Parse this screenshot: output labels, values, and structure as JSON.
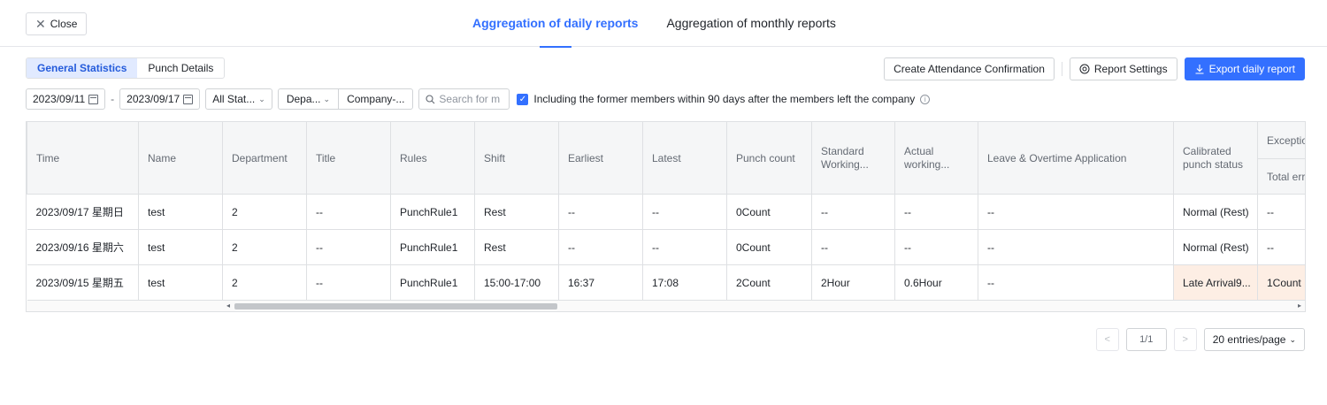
{
  "topbar": {
    "close_label": "Close",
    "tabs": [
      {
        "label": "Aggregation of daily reports",
        "active": true
      },
      {
        "label": "Aggregation of monthly reports",
        "active": false
      }
    ]
  },
  "view_toggle": {
    "items": [
      {
        "label": "General Statistics",
        "active": true
      },
      {
        "label": "Punch Details",
        "active": false
      }
    ]
  },
  "actions": {
    "create_confirmation": "Create Attendance Confirmation",
    "report_settings": "Report Settings",
    "export": "Export daily report"
  },
  "filters": {
    "start_date": "2023/09/11",
    "end_date": "2023/09/17",
    "status": "All Stat...",
    "department": "Depa...",
    "company": "Company-...",
    "search_placeholder": "Search for m",
    "include_former": {
      "checked": true,
      "label": "Including the former members within 90 days after the members left the company"
    }
  },
  "table": {
    "columns": [
      "Time",
      "Name",
      "Department",
      "Title",
      "Rules",
      "Shift",
      "Earliest",
      "Latest",
      "Punch count",
      "Standard Working...",
      "Actual working...",
      "Leave & Overtime Application",
      "Calibrated punch status",
      "Exceptio"
    ],
    "sub_header": "Total err",
    "rows": [
      [
        "2023/09/17 星期日",
        "test",
        "2",
        "--",
        "PunchRule1",
        "Rest",
        "--",
        "--",
        "0Count",
        "--",
        "--",
        "--",
        "Normal (Rest)",
        "--"
      ],
      [
        "2023/09/16 星期六",
        "test",
        "2",
        "--",
        "PunchRule1",
        "Rest",
        "--",
        "--",
        "0Count",
        "--",
        "--",
        "--",
        "Normal (Rest)",
        "--"
      ],
      [
        "2023/09/15 星期五",
        "test",
        "2",
        "--",
        "PunchRule1",
        "15:00-17:00",
        "16:37",
        "17:08",
        "2Count",
        "2Hour",
        "0.6Hour",
        "--",
        "Late Arrival9...",
        "1Count"
      ]
    ]
  },
  "pagination": {
    "page": "1/1",
    "page_size": "20 entries/page"
  },
  "colors": {
    "accent": "#3370ff",
    "highlight_cell": "#fdeee4"
  }
}
